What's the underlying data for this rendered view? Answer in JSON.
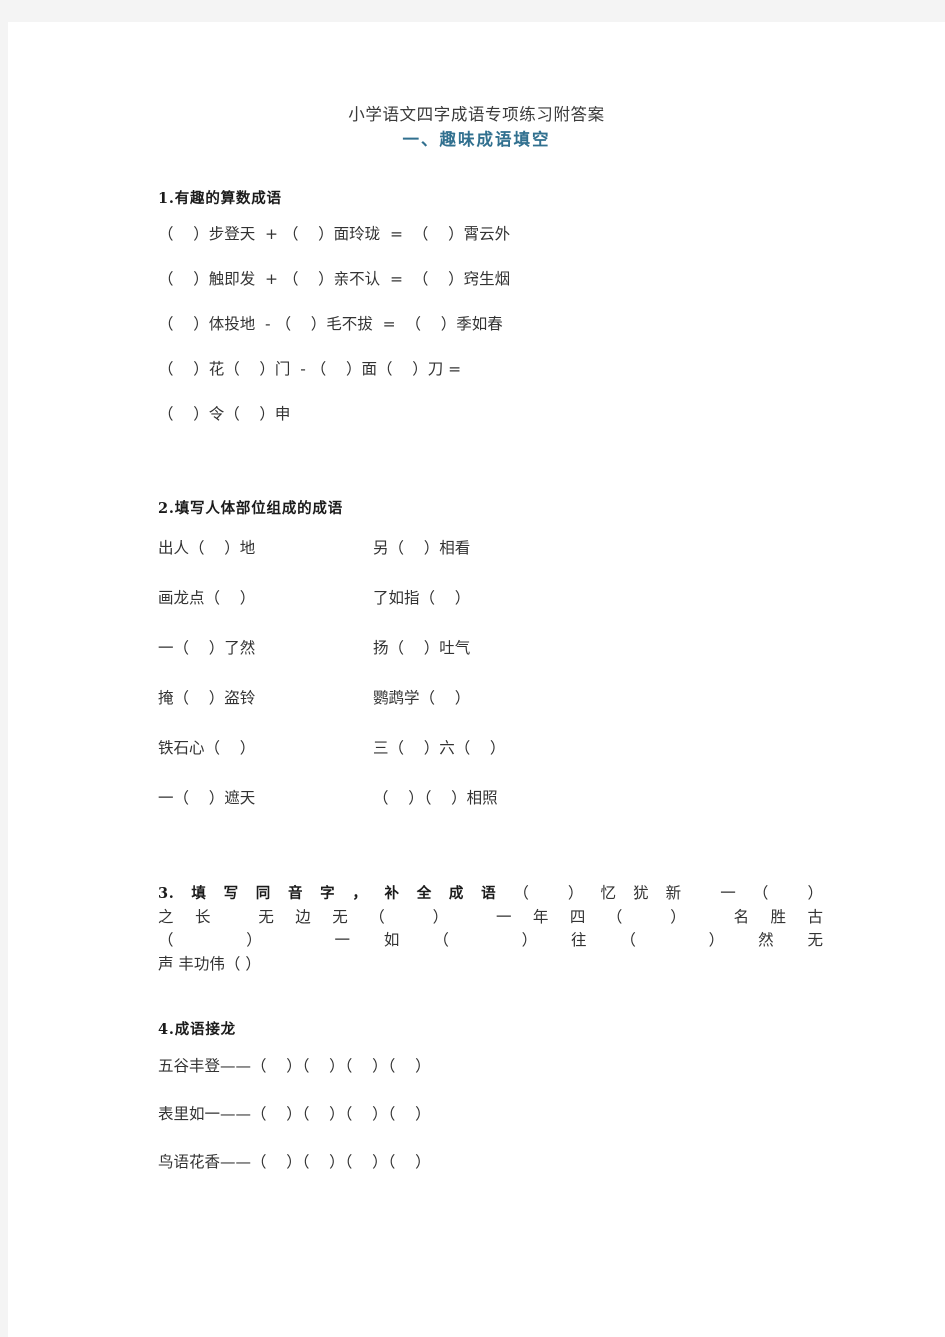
{
  "document": {
    "title": "小学语文四字成语专项练习附答案",
    "subtitle": "一、趣味成语填空",
    "subtitle_color": "#31708f",
    "body_color": "#333333"
  },
  "sections": [
    {
      "id": "section-1",
      "heading": "1.有趣的算数成语",
      "lines": [
        "（    ）步登天  + （    ）面玲珑  =  （    ）霄云外",
        "（    ）触即发  + （    ）亲不认  =  （    ）窍生烟",
        "（    ）体投地  - （    ）毛不拔  =  （    ）季如春",
        "（    ）花（    ）门  - （    ）面（    ）刀 =",
        "（    ）令（    ）申"
      ]
    },
    {
      "id": "section-2",
      "heading": "2.填写人体部位组成的成语",
      "rows": [
        {
          "left": "出人（    ）地",
          "right": "另（    ）相看"
        },
        {
          "left": "画龙点（    ）",
          "right": "了如指（    ）"
        },
        {
          "left": "一（    ）了然",
          "right": "扬（    ）吐气"
        },
        {
          "left": "掩（    ）盗铃",
          "right": "鹦鹉学（    ）"
        },
        {
          "left": "铁石心（    ）",
          "right": "三（    ）六（    ）"
        },
        {
          "left": "一（    ）遮天",
          "right": "（    ）（    ）相照"
        }
      ]
    },
    {
      "id": "section-3",
      "heading": "3.填写同音字，补全成语",
      "paragraph_lines": [
        "（    ）忆犹新                        一（    ）",
        "之长  无边无（    ）                  一年四（    ）  名胜古",
        "（    ）                      一如（    ）往（    ）然无",
        "声            丰功伟（    ）"
      ],
      "inline_flow": "（    ）忆犹新 一（    ）之长 无边无（    ） 一年四（    ） 名胜古（    ） 一如（    ）往 （    ）然无声 丰功伟（    ）"
    },
    {
      "id": "section-4",
      "heading": "4.成语接龙",
      "lines": [
        "五谷丰登——（    ）（    ）（    ）（    ）",
        "表里如一——（    ）（    ）（    ）（    ）",
        "鸟语花香——（    ）（    ）（    ）（    ）"
      ]
    }
  ]
}
